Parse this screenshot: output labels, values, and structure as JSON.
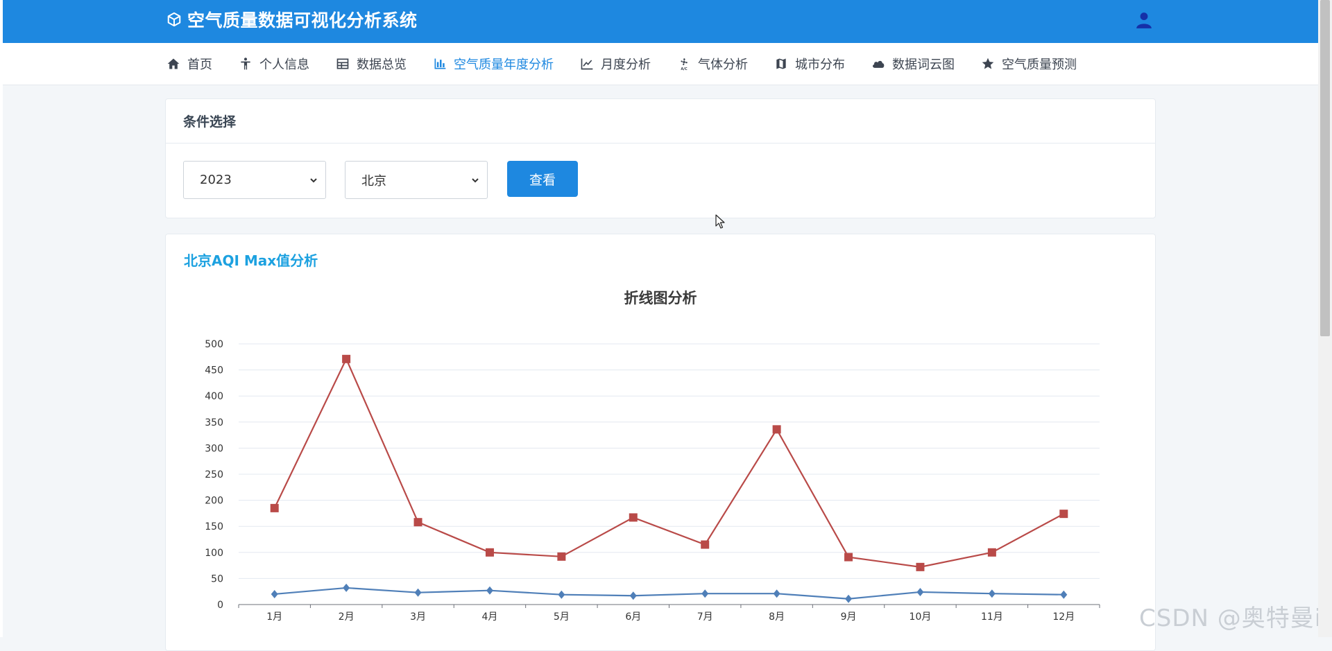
{
  "app": {
    "title": "空气质量数据可视化分析系统"
  },
  "nav": [
    {
      "label": "首页",
      "icon": "home-icon"
    },
    {
      "label": "个人信息",
      "icon": "person-icon"
    },
    {
      "label": "数据总览",
      "icon": "table-icon"
    },
    {
      "label": "空气质量年度分析",
      "icon": "bar-chart-icon",
      "active": true
    },
    {
      "label": "月度分析",
      "icon": "line-chart-icon"
    },
    {
      "label": "气体分析",
      "icon": "fan-icon"
    },
    {
      "label": "城市分布",
      "icon": "map-icon"
    },
    {
      "label": "数据词云图",
      "icon": "cloud-icon"
    },
    {
      "label": "空气质量预测",
      "icon": "star-icon"
    }
  ],
  "filter": {
    "title": "条件选择",
    "year": "2023",
    "city": "北京",
    "submit_label": "查看"
  },
  "chart_section": {
    "heading": "北京AQI Max值分析"
  },
  "chart_data": {
    "type": "line",
    "title": "折线图分析",
    "categories": [
      "1月",
      "2月",
      "3月",
      "4月",
      "5月",
      "6月",
      "7月",
      "8月",
      "9月",
      "10月",
      "11月",
      "12月"
    ],
    "series": [
      {
        "color": "#b94a48",
        "marker": "square",
        "values": [
          185,
          471,
          158,
          100,
          92,
          167,
          115,
          336,
          91,
          72,
          100,
          174
        ]
      },
      {
        "color": "#4f7fb8",
        "marker": "diamond",
        "values": [
          20,
          32,
          23,
          27,
          19,
          17,
          21,
          21,
          11,
          24,
          21,
          19
        ]
      }
    ],
    "yticks": [
      0,
      50,
      100,
      150,
      200,
      250,
      300,
      350,
      400,
      450,
      500
    ],
    "ylim": [
      0,
      500
    ],
    "grid": true
  },
  "colors": {
    "accent": "#1e88e0",
    "heading": "#1ca1e0"
  },
  "watermark": "CSDN @奥特曼it"
}
